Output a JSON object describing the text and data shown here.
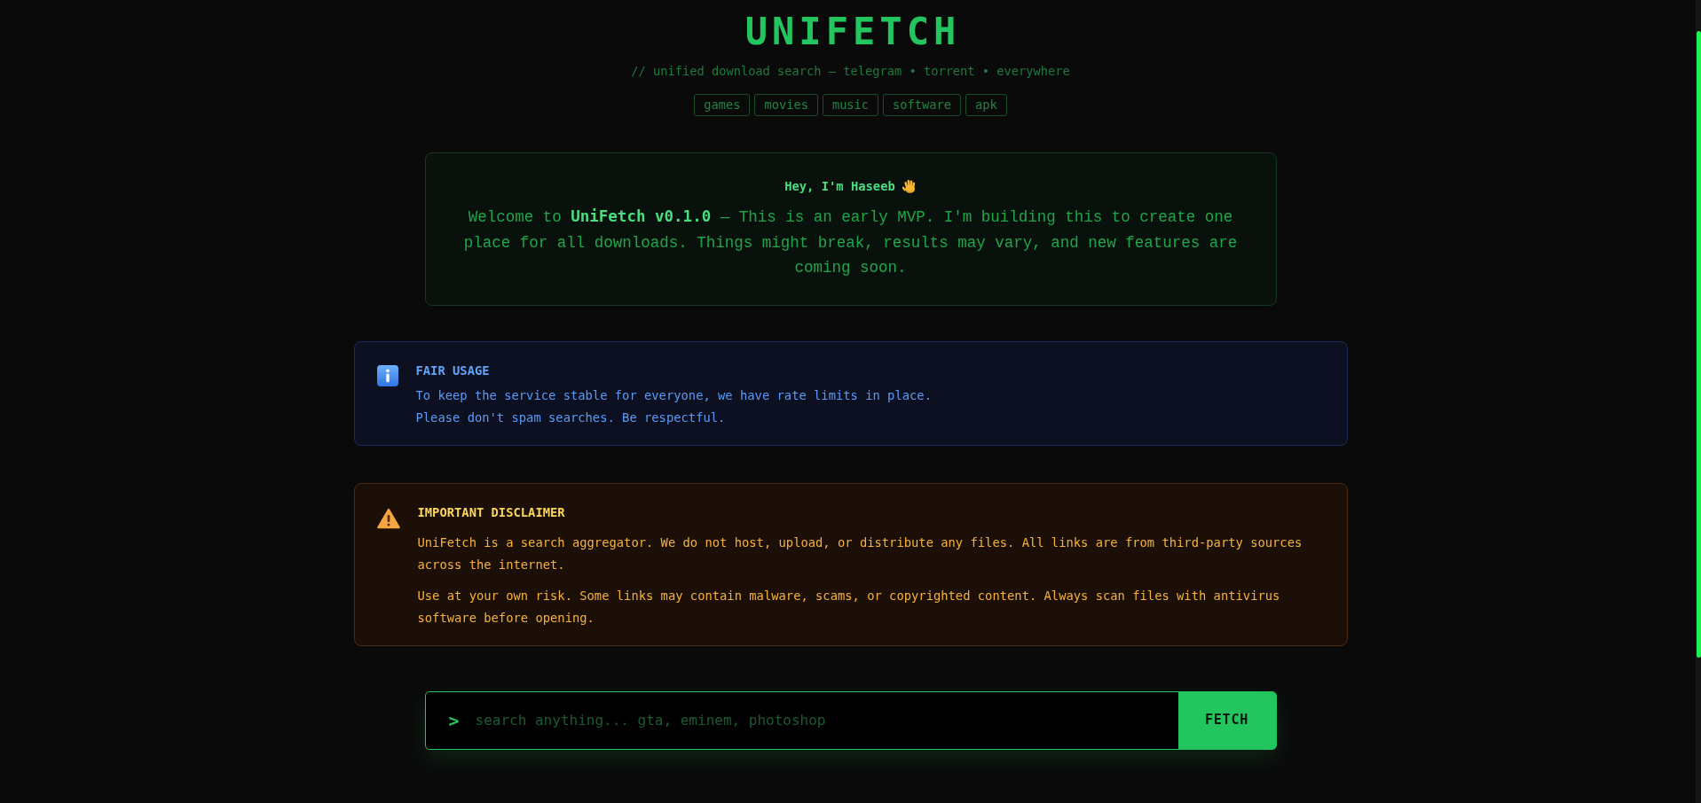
{
  "header": {
    "title": "UNIFETCH",
    "subtitle": "// unified download search — telegram • torrent • everywhere",
    "tags": [
      "games",
      "movies",
      "music",
      "software",
      "apk"
    ]
  },
  "welcome": {
    "greeting": "Hey, I'm Haseeb",
    "message": "Welcome to **UniFetch v0.1.0** — This is an early MVP. I'm building this to create one place for all downloads. Things might break, results may vary, and new features are coming soon."
  },
  "notices": [
    {
      "kind": "info",
      "title": "FAIR USAGE",
      "paragraphs": [
        "To keep the service stable for everyone, we have rate limits in place.",
        "Please don't spam searches. Be respectful."
      ]
    },
    {
      "kind": "warning",
      "title": "IMPORTANT DISCLAIMER",
      "paragraphs": [
        "UniFetch is a search aggregator. We do not host, upload, or distribute any files. All links are from third-party sources across the internet.",
        "Use at your own risk. Some links may contain malware, scams, or copyrighted content. Always scan files with antivirus software before opening."
      ]
    }
  ],
  "search": {
    "prompt": ">",
    "placeholder": "search anything... gta, eminem, photoshop",
    "button": "FETCH"
  }
}
